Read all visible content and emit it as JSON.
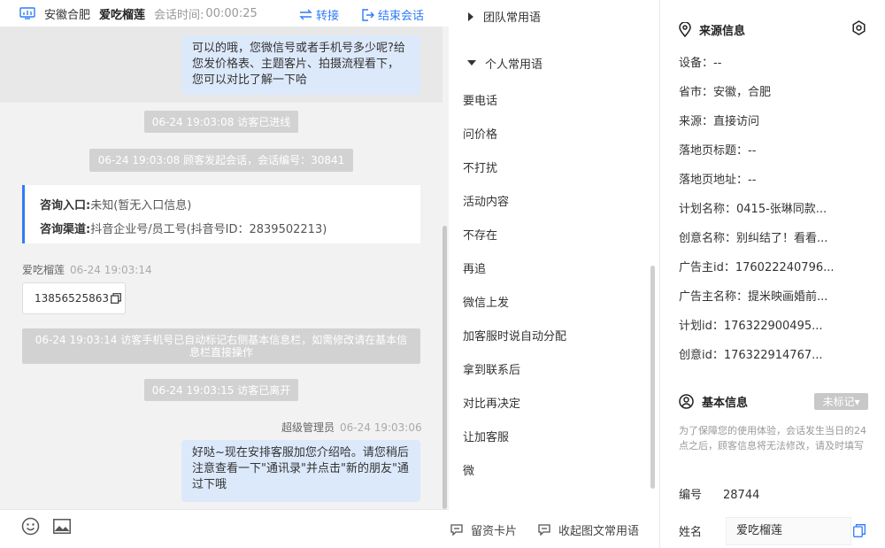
{
  "header": {
    "location": "安徽合肥",
    "visitor_name": "爱吃榴莲",
    "time_label": "会话时间:",
    "timer": "00:00:25",
    "transfer": "转接",
    "end_chat": "结束会话"
  },
  "messages": {
    "agent_top": "可以的哦，您微信号或者手机号多少呢?给您发价格表、主题客片、拍摄流程看下，您可以对比了解一下哈",
    "sys_enter": "06-24 19:03:08 访客已进线",
    "sys_session": "06-24 19:03:08 顾客发起会话，会话编号：30841",
    "entry_label": "咨询入口:",
    "entry_value": "未知(暂无入口信息)",
    "channel_label": "咨询渠道:",
    "channel_value": "抖音企业号/员工号(抖音号ID：2839502213)",
    "visitor_name": "爱吃榴莲",
    "visitor_time": "06-24 19:03:14",
    "visitor_phone": "13856525863",
    "sys_phone_mark": "06-24 19:03:14 访客手机号已自动标记右侧基本信息栏，如需修改请在基本信息栏直接操作",
    "sys_leave": "06-24 19:03:15 访客已离开",
    "agent_name": "超级管理员",
    "agent_time": "06-24 19:03:06",
    "agent_bottom": "好哒~现在安排客服加您介绍哈。请您稍后注意查看一下\"通讯录\"并点击\"新的朋友\"通过下哦"
  },
  "phrases": {
    "team_group": "团队常用语",
    "personal_group": "个人常用语",
    "items": [
      "要电话",
      "问价格",
      "不打扰",
      "活动内容",
      "不存在",
      "再追",
      "微信上发",
      "加客服时说自动分配",
      "拿到联系后",
      "对比再决定",
      "让加客服",
      "微"
    ],
    "footer_card": "留资卡片",
    "footer_collect": "收起图文常用语"
  },
  "info": {
    "source_title": "来源信息",
    "source": [
      "设备：--",
      "省市：安徽，合肥",
      "来源：直接访问",
      "落地页标题：--",
      "落地页地址：--",
      "计划名称：0415-张琳同款...",
      "创意名称：别纠结了！看看...",
      "广告主id：176022240796...",
      "广告主名称：提米映画婚前...",
      "计划id：176322900495...",
      "创意id：176322914767..."
    ],
    "basic_title": "基本信息",
    "tag_button": "未标记▾",
    "notice": "为了保障您的使用体验，会话发生当日的24点之后，顾客信息将无法修改，请及时填写",
    "number_label": "编号",
    "number_value": "28744",
    "name_label": "姓名",
    "name_value": "爱吃榴莲"
  },
  "colors": {
    "accent": "#2f7cf6",
    "agent_bubble": "#dce9fb",
    "system_msg": "#d2d2d2"
  }
}
